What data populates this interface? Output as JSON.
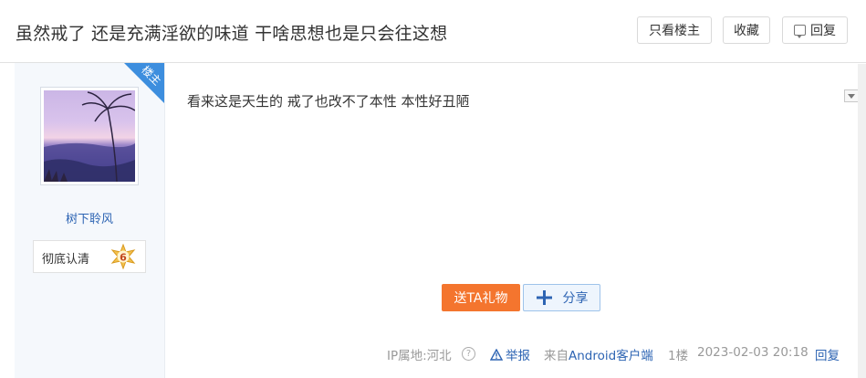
{
  "thread": {
    "title": "虽然戒了 还是充满淫欲的味道 干啥思想也是只会往这想"
  },
  "header_buttons": {
    "only_op": "只看楼主",
    "favorite": "收藏",
    "reply": "回复"
  },
  "post": {
    "op_badge": "楼主",
    "username": "树下聆风",
    "level_title": "彻底认清",
    "level": "6",
    "content": "看来这是天生的 戒了也改不了本性 本性好丑陋",
    "gift_button": "送TA礼物",
    "share_button": "分享",
    "ip_location": "IP属地:河北",
    "help_glyph": "?",
    "report": "举报",
    "from_prefix": "来自",
    "client": "Android客户端",
    "floor": "1楼",
    "datetime": "2023-02-03 20:18",
    "reply": "回复"
  },
  "colors": {
    "link_blue": "#2d64b3",
    "gift_orange": "#f4752e",
    "badge_blue": "#3d8ede"
  },
  "icons": [
    "reply-icon",
    "op-badge",
    "level-star-icon",
    "share-plus-icon",
    "help-icon",
    "warning-icon",
    "menu-toggle-icon"
  ]
}
